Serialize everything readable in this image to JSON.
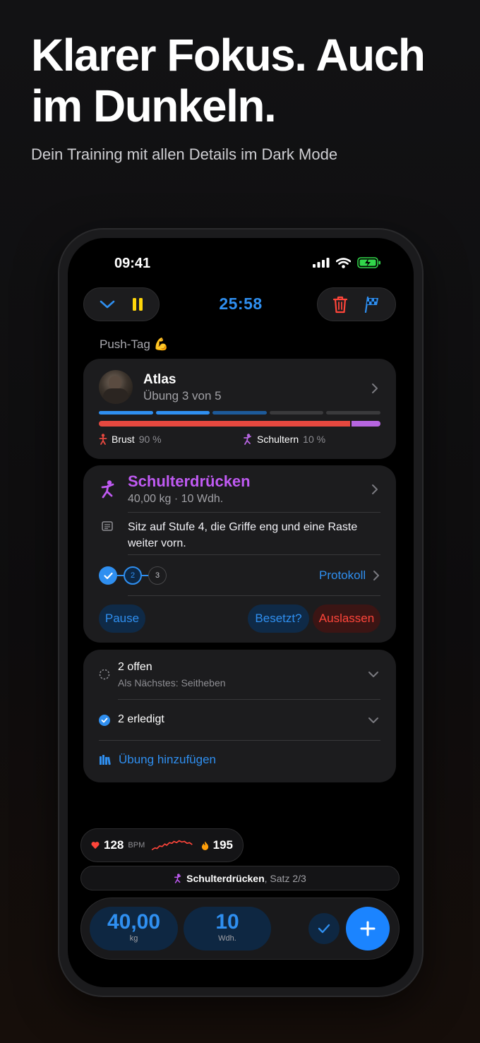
{
  "promo": {
    "headline": "Klarer Fokus. Auch im Dunkeln.",
    "subline": "Dein Training mit allen Details im Dark Mode"
  },
  "status_bar": {
    "time": "09:41"
  },
  "toolbar": {
    "timer": "25:58",
    "collapse_icon": "chevron-down-icon",
    "pause_icon": "pause-icon",
    "delete_icon": "trash-icon",
    "finish_icon": "checkered-flag-icon"
  },
  "workout": {
    "name": "Push-Tag 💪"
  },
  "current_exercise_card": {
    "machine_name": "Atlas",
    "progress_text": "Übung 3 von 5",
    "exercise_progress": {
      "done": 3,
      "total": 5
    },
    "muscle_split": [
      {
        "name": "Brust",
        "percent_label": "90 %",
        "share": 0.9,
        "color": "#e5483f"
      },
      {
        "name": "Schultern",
        "percent_label": "10 %",
        "share": 0.1,
        "color": "#b665e0"
      }
    ]
  },
  "exercise_card": {
    "title": "Schulterdrücken",
    "subtitle": "40,00 kg · 10 Wdh.",
    "note": "Sitz auf Stufe 4, die Griffe eng und eine Raste weiter vorn.",
    "sets": [
      "✓",
      "2",
      "3"
    ],
    "protocol_link": "Protokoll",
    "buttons": {
      "pause": "Pause",
      "occupied": "Besetzt?",
      "skip": "Auslassen"
    }
  },
  "lists": {
    "open_label": "2 offen",
    "open_next": "Als Nächstes: Seitheben",
    "done_label": "2 erledigt",
    "add_exercise": "Übung hinzufügen"
  },
  "health": {
    "heart_rate": "128",
    "heart_unit": "BPM",
    "calories": "195"
  },
  "current_set_banner": {
    "exercise": "Schulterdrücken",
    "set_info": ", Satz 2/3"
  },
  "input_bar": {
    "weight_value": "40,00",
    "weight_unit": "kg",
    "reps_value": "10",
    "reps_unit": "Wdh."
  },
  "colors": {
    "accent": "#2f8ff0",
    "yellow": "#ffd60a",
    "red": "#ff453a",
    "purple": "#bf5af2"
  }
}
